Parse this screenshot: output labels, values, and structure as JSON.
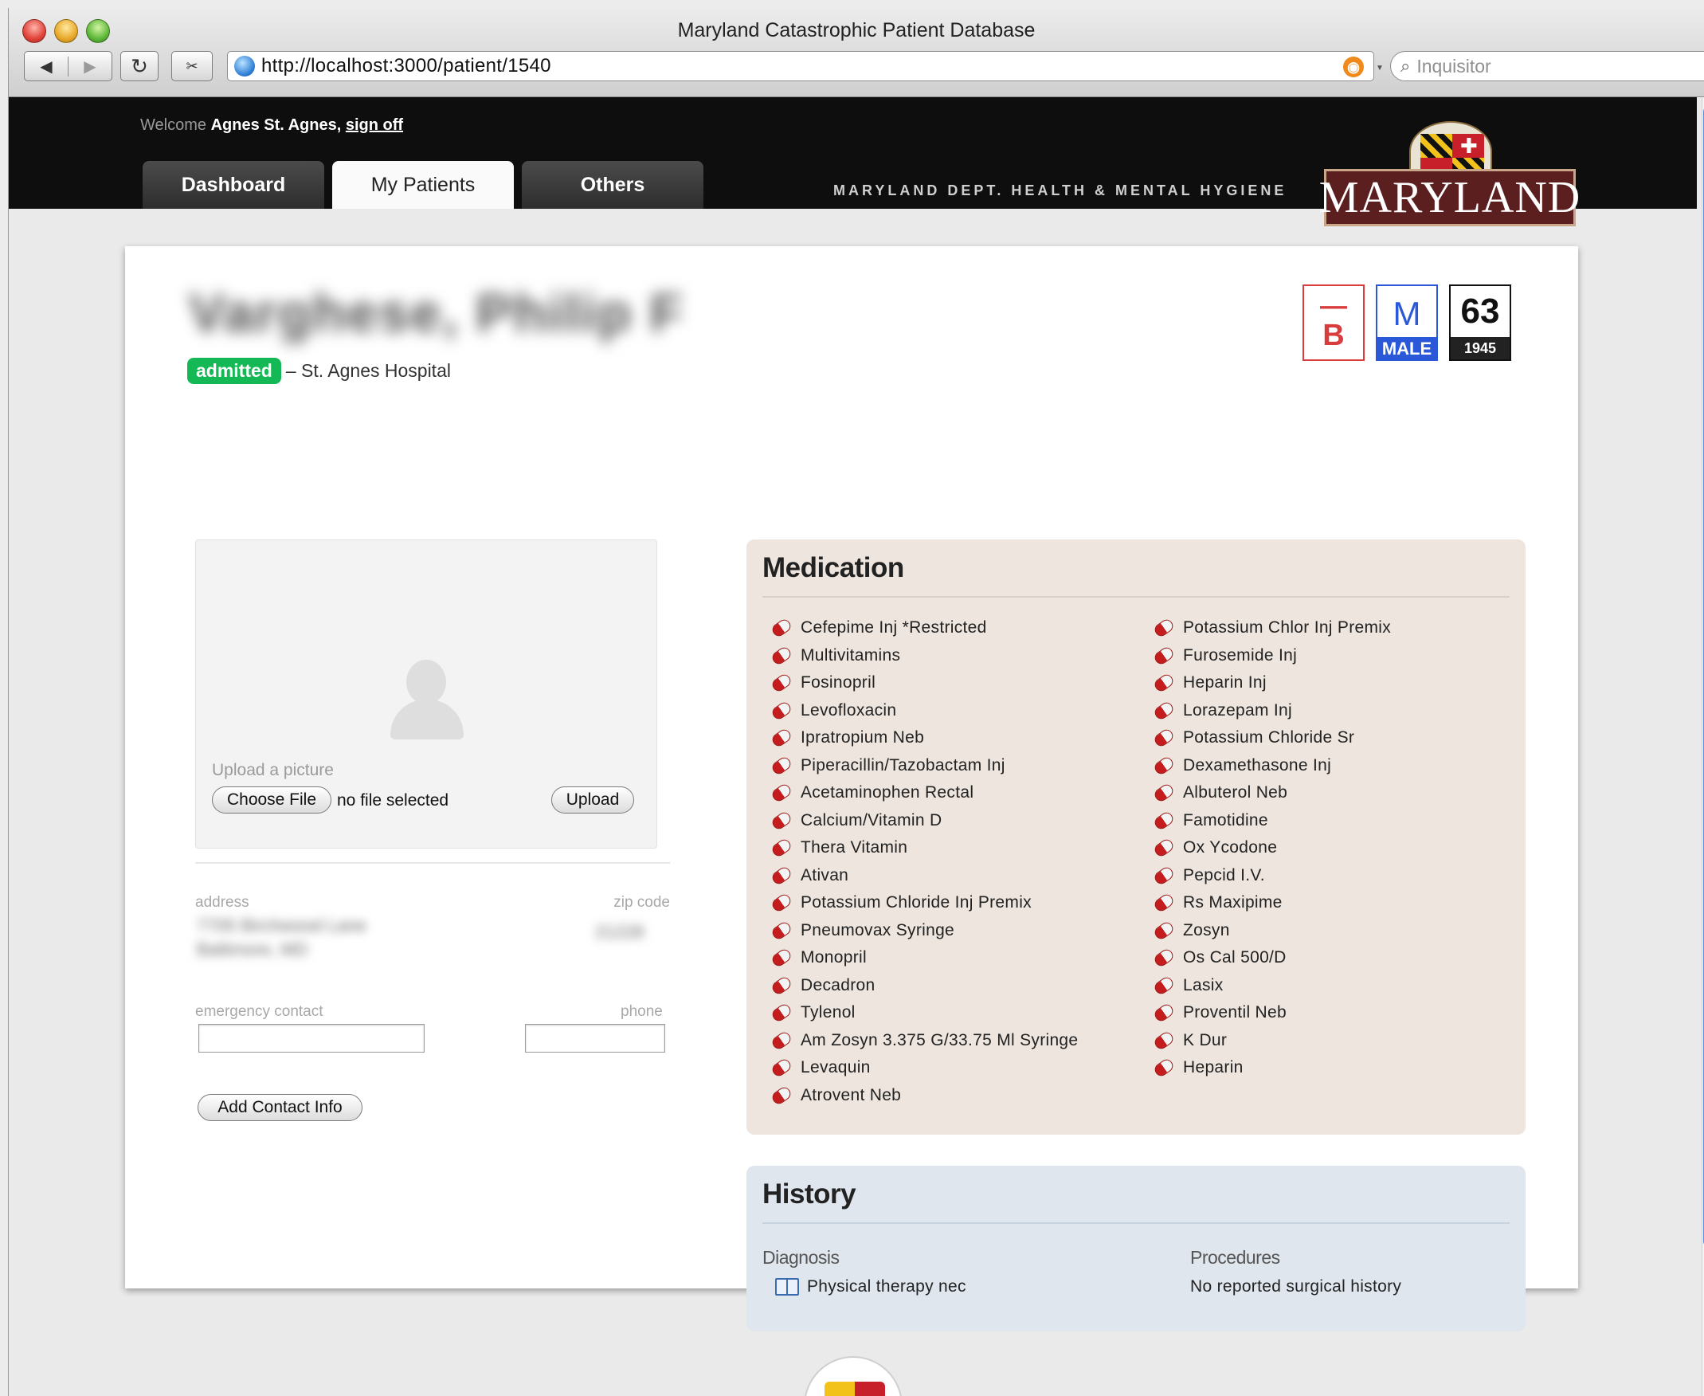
{
  "window": {
    "title": "Maryland Catastrophic Patient Database"
  },
  "toolbar": {
    "back_icon": "◀",
    "forward_icon": "▶",
    "reload_icon": "↻",
    "clip_icon": "✂",
    "url": "http://localhost:3000/patient/1540",
    "search_placeholder": "Inquisitor"
  },
  "header": {
    "welcome_label": "Welcome",
    "user_name": "Agnes St. Agnes,",
    "sign_off": "sign off",
    "tabs": [
      {
        "label": "Dashboard",
        "active": false
      },
      {
        "label": "My Patients",
        "active": true
      },
      {
        "label": "Others",
        "active": false
      }
    ],
    "dept": "MARYLAND DEPT. HEALTH & MENTAL HYGIENE",
    "logo_text": "MARYLAND"
  },
  "patient": {
    "name": "Varghese, Philip F",
    "status": "admitted",
    "hospital": "– St. Agnes Hospital",
    "blood_dash": "—",
    "blood_type": "B",
    "sex_code": "M",
    "sex_label": "MALE",
    "age": "63",
    "birth_year": "1945"
  },
  "profile": {
    "upload_label": "Upload a picture",
    "choose_file": "Choose File",
    "file_status": "no file selected",
    "upload_button": "Upload",
    "address_label": "address",
    "address_line1": "7705 Birchwood Lane",
    "address_line2": "Baltimore, MD",
    "zip_label": "zip code",
    "zip_value": "21228",
    "emergency_label": "emergency contact",
    "phone_label": "phone",
    "emergency_value": "",
    "phone_value": "",
    "add_contact_button": "Add Contact Info"
  },
  "medication": {
    "title": "Medication",
    "column1": [
      "Cefepime Inj *Restricted",
      "Multivitamins",
      "Fosinopril",
      "Levofloxacin",
      "Ipratropium Neb",
      "Piperacillin/Tazobactam Inj",
      "Acetaminophen Rectal",
      "Calcium/Vitamin D",
      "Thera Vitamin",
      "Ativan",
      "Potassium Chloride Inj Premix",
      "Pneumovax Syringe",
      "Monopril",
      "Decadron",
      "Tylenol",
      "Am Zosyn 3.375 G/33.75 Ml Syringe",
      "Levaquin",
      "Atrovent Neb"
    ],
    "column2": [
      "Potassium Chlor Inj Premix",
      "Furosemide Inj",
      "Heparin Inj",
      "Lorazepam Inj",
      "Potassium Chloride Sr",
      "Dexamethasone Inj",
      "Albuterol Neb",
      "Famotidine",
      "Ox Ycodone",
      "Pepcid I.V.",
      "Rs Maxipime",
      "Zosyn",
      "Os Cal 500/D",
      "Lasix",
      "Proventil Neb",
      "K Dur",
      "Heparin"
    ]
  },
  "history": {
    "title": "History",
    "diagnosis_label": "Diagnosis",
    "diagnosis": "Physical therapy nec",
    "procedures_label": "Procedures",
    "procedures": "No reported surgical history"
  },
  "colors": {
    "admitted": "#14b854",
    "blood": "#d83c3c",
    "male": "#2a58d8",
    "medication_bg": "#ede5de",
    "history_bg": "#dfe6ee"
  }
}
